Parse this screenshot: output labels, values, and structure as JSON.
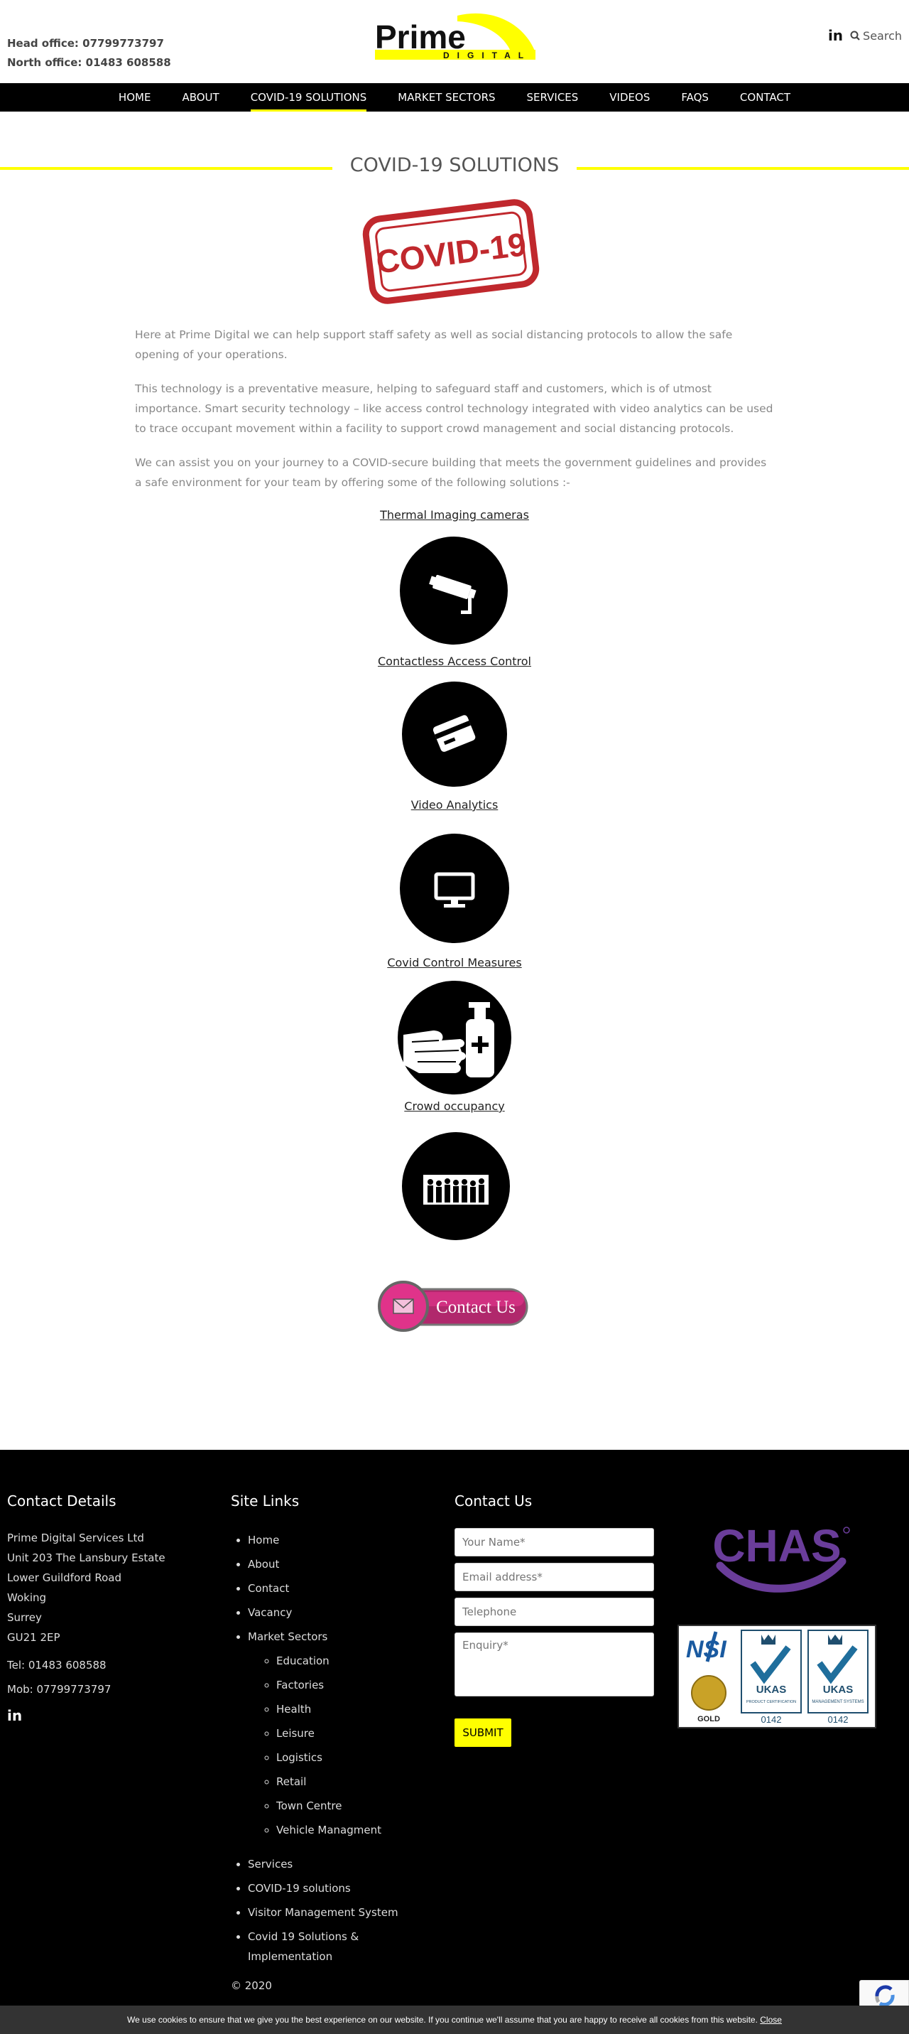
{
  "header": {
    "head_office": "Head office: 07799773797",
    "north_office": "North office: 01483 608588",
    "logo_text_main": "Prime",
    "logo_text_sub": "DIGITAL",
    "linkedin_icon": "linkedin-icon",
    "search_label": "Search"
  },
  "nav": {
    "items": [
      {
        "label": "HOME"
      },
      {
        "label": "ABOUT"
      },
      {
        "label": "COVID-19 SOLUTIONS",
        "active": true
      },
      {
        "label": "MARKET SECTORS"
      },
      {
        "label": "SERVICES"
      },
      {
        "label": "VIDEOS"
      },
      {
        "label": "FAQS"
      },
      {
        "label": "CONTACT"
      }
    ]
  },
  "main": {
    "title": "COVID-19 SOLUTIONS",
    "hero_stamp_text": "COVID-19",
    "paragraphs": [
      "Here at Prime Digital we can help support staff safety as well as social distancing protocols to allow the safe opening of your operations.",
      "This technology is a preventative measure, helping to safeguard staff and customers, which is of utmost importance. Smart security technology – like access control technology integrated with video analytics can be used to trace occupant movement within a facility to support crowd management and social distancing protocols.",
      "We can assist you on your journey to a COVID-secure building that meets the government guidelines and provides a safe environment for your team by offering some of the following solutions :-"
    ],
    "solutions": [
      {
        "title": "Thermal Imaging cameras",
        "icon": "cctv-camera-icon"
      },
      {
        "title": "Contactless Access Control",
        "icon": "access-card-icon"
      },
      {
        "title": "Video Analytics",
        "icon": "monitor-icon"
      },
      {
        "title": "Covid Control Measures",
        "icon": "hand-sanitiser-icon"
      },
      {
        "title": "Crowd occupancy",
        "icon": "crowd-icon"
      }
    ],
    "contact_button": "Contact Us"
  },
  "footer": {
    "contact_details": {
      "heading": "Contact Details",
      "address": [
        "Prime Digital Services Ltd",
        "Unit 203 The Lansbury Estate",
        "Lower Guildford Road",
        "Woking",
        "Surrey",
        "GU21 2EP"
      ],
      "tel": "Tel: 01483 608588",
      "mob": "Mob: 07799773797"
    },
    "site_links": {
      "heading": "Site Links",
      "items": [
        "Home",
        "About",
        "Contact",
        "Vacancy",
        "Market Sectors"
      ],
      "sub_items": [
        "Education",
        "Factories",
        "Health",
        "Leisure",
        "Logistics",
        "Retail",
        "Town Centre",
        "Vehicle Managment"
      ],
      "more_items": [
        "Services",
        "COVID-19 solutions",
        "Visitor Management System",
        "Covid 19 Solutions & Implementation"
      ],
      "copyright": "© 2020"
    },
    "contact_form": {
      "heading": "Contact Us",
      "name_placeholder": "Your Name*",
      "email_placeholder": "Email address*",
      "telephone_placeholder": "Telephone",
      "enquiry_placeholder": "Enquiry*",
      "submit_label": "SUBMIT"
    },
    "accreditations": {
      "chas": "CHAS",
      "nsi": "NSI",
      "nsi_level": "GOLD",
      "ukas1_title": "UKAS",
      "ukas1_sub": "PRODUCT CERTIFICATION",
      "ukas1_num": "0142",
      "ukas2_title": "UKAS",
      "ukas2_sub": "MANAGEMENT SYSTEMS",
      "ukas2_num": "0142"
    }
  },
  "cookie": {
    "text": "We use cookies to ensure that we give you the best experience on our website. If you continue we'll assume that you are happy to receive all cookies from this website.",
    "close_label": "Close"
  },
  "colors": {
    "accent_yellow": "#ffff00",
    "nav_bg": "#000000",
    "footer_bg": "#000000",
    "chas_purple": "#6a3d9a",
    "stamp_red": "#c0282d",
    "contact_pink": "#e0338a"
  }
}
